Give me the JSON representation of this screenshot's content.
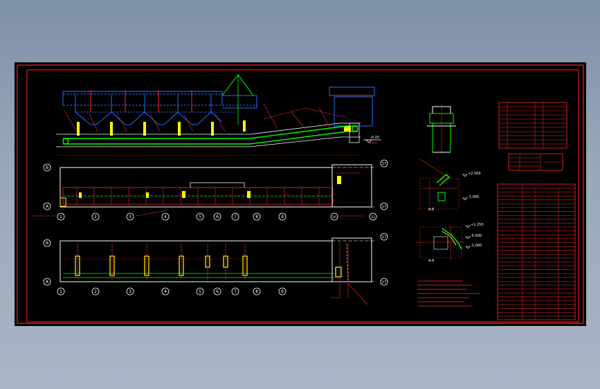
{
  "colors": {
    "background": "#000000",
    "frame": "#ff2020",
    "steel": "#ffffff",
    "conveyor": "#00ff00",
    "dimension": "#ff2a2a",
    "hopper": "#2a6bff",
    "support": "#ffff00",
    "annotation": "#00ffff",
    "hatch": "#ff00ff"
  },
  "elevation": {
    "level_marks": [
      "-0.20",
      "0.50"
    ]
  },
  "plan_upper": {
    "row_axes": [
      "B",
      "A"
    ],
    "col_axes": [
      "1",
      "2",
      "3",
      "4",
      "5",
      "6",
      "7",
      "8",
      "9",
      "10",
      "11"
    ],
    "right_axes": [
      "17",
      "17"
    ]
  },
  "plan_lower": {
    "row_axes": [
      "B",
      "A"
    ],
    "col_axes": [
      "1",
      "2",
      "3",
      "4",
      "5",
      "6",
      "7",
      "8",
      "9"
    ],
    "right_axes": [
      "17",
      "17"
    ]
  },
  "sections": {
    "level_marks": [
      "+2.500",
      "-1.000",
      "+1.250",
      "-0.500",
      "-1.000"
    ],
    "labels": [
      "B-B",
      "A-A"
    ]
  },
  "icons": [
    "axis-bubble-icon",
    "level-marker-icon",
    "hopper-icon",
    "conveyor-belt-icon",
    "support-column-icon",
    "material-table-icon",
    "title-block-icon"
  ]
}
